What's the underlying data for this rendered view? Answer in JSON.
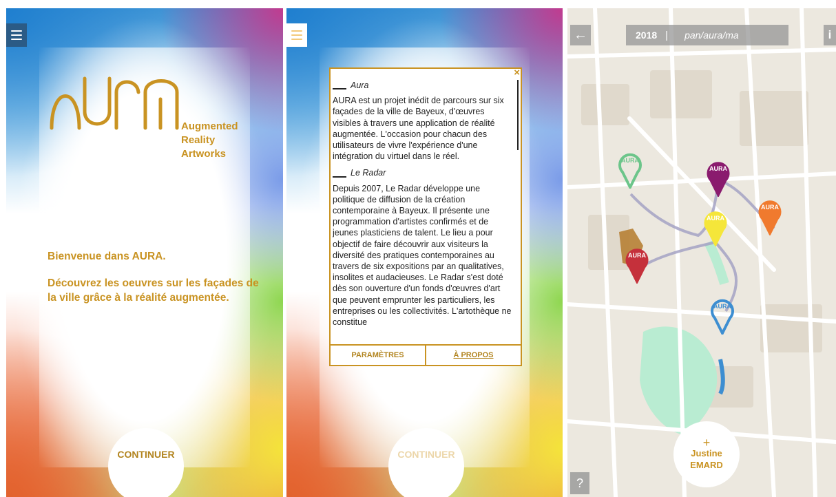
{
  "accent_color": "#c99322",
  "screen1": {
    "menu_icon": "hamburger-icon",
    "logo_text": "AURA",
    "tagline": [
      "Augmented",
      "Reality",
      "Artworks"
    ],
    "welcome": "Bienvenue dans AURA.",
    "description": "Découvrez les oeuvres sur les façades de la ville grâce à la réalité augmentée.",
    "continue_label": "CONTINUER"
  },
  "screen2": {
    "menu_icon": "hamburger-icon",
    "close_label": "×",
    "section1_title": "Aura",
    "section1_text": "AURA est un projet inédit de parcours sur six façades de la ville de Bayeux, d'œuvres visibles à travers une application de réalité augmentée. L'occasion pour chacun des utilisateurs de vivre l'expérience d'une intégration du virtuel dans le réel.",
    "section2_title": "Le Radar",
    "section2_text": "Depuis 2007, Le Radar développe une politique de diffusion de la création contemporaine à Bayeux. Il présente une programmation d'artistes confirmés et de jeunes plasticiens de talent. Le lieu a pour objectif de faire découvrir aux visiteurs la diversité des pratiques contemporaines au travers de six expositions par an qualitatives, insolites et audacieuses. Le Radar s'est doté dès son ouverture d'un fonds d'œuvres d'art que peuvent emprunter les particuliers, les entreprises ou les collectivités. L'artothèque ne constitue",
    "tab_settings": "PARAMÈTRES",
    "tab_about": "À PROPOS",
    "continue_label": "CONTINUER"
  },
  "screen3": {
    "back_label": "←",
    "year": "2018",
    "separator": "|",
    "path": "pan/aura/ma",
    "info_label": "i",
    "help_label": "?",
    "plus_label": "+",
    "artist_first": "Justine",
    "artist_last": "EMARD",
    "pin_label": "AURA",
    "pins": [
      {
        "color": "#6cc58a"
      },
      {
        "color": "#8a1b6e"
      },
      {
        "color": "#f07a2e"
      },
      {
        "color": "#f5e63a"
      },
      {
        "color": "#c5303b"
      },
      {
        "color": "#3d8ed1"
      }
    ]
  }
}
